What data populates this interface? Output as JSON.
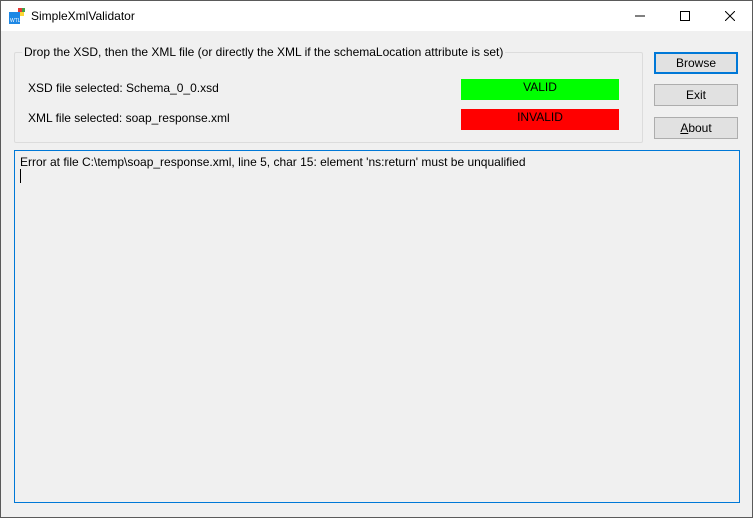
{
  "window": {
    "title": "SimpleXmlValidator",
    "icon": "wtl-app-icon",
    "controls": {
      "minimize": "minimize-icon",
      "maximize": "maximize-icon",
      "close": "close-icon"
    }
  },
  "group": {
    "legend": "Drop the XSD, then the XML file (or directly the XML if the schemaLocation attribute is set)",
    "xsd_label": "XSD file selected: Schema_0_0.xsd",
    "xml_label": "XML file selected: soap_response.xml",
    "xsd_status": "VALID",
    "xml_status": "INVALID",
    "colors": {
      "valid": "#00ff00",
      "invalid": "#ff0000"
    }
  },
  "buttons": {
    "browse": "Browse",
    "exit": "Exit",
    "about_mnemonic": "A",
    "about_rest": "bout"
  },
  "output": {
    "text": "Error at file C:\\temp\\soap_response.xml, line 5, char 15: element 'ns:return' must be unqualified"
  }
}
